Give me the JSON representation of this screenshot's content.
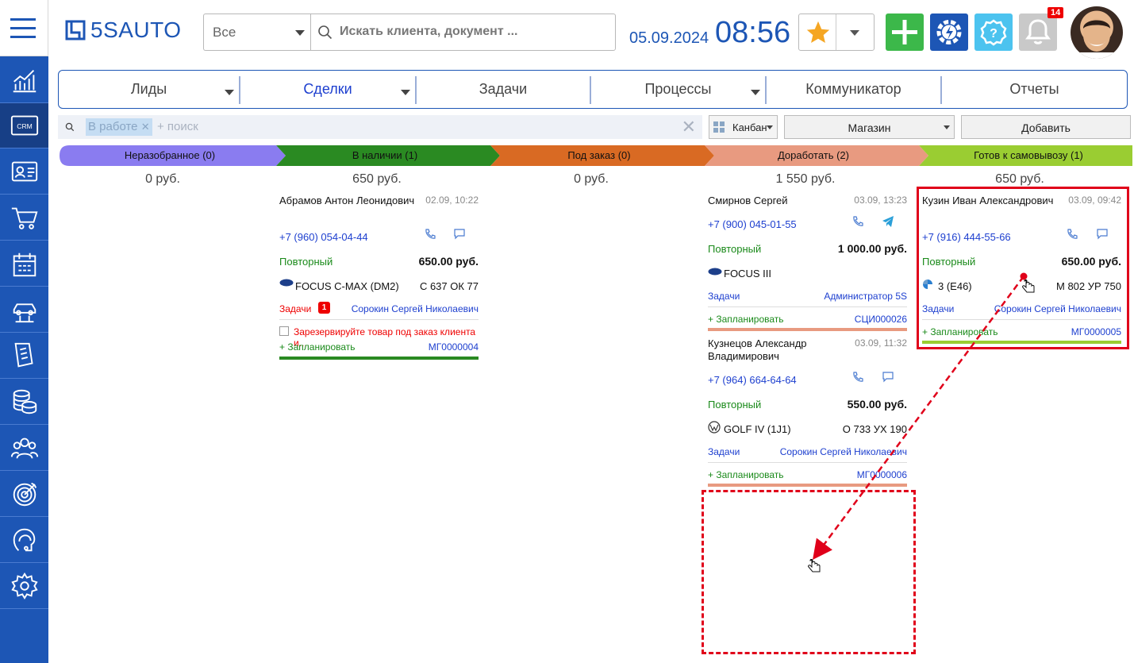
{
  "header": {
    "logo_text": "5SAUTO",
    "search_scope": "Все",
    "search_placeholder": "Искать клиента, документ ...",
    "date": "05.09.2024",
    "time": "08:56",
    "notifications_count": "14"
  },
  "sidebar": {
    "items": [
      "analytics-icon",
      "crm-icon",
      "contacts-icon",
      "cart-icon",
      "calendar-icon",
      "car-lift-icon",
      "documents-icon",
      "finance-icon",
      "team-icon",
      "target-icon",
      "support-icon",
      "settings-icon"
    ],
    "crm_label": "CRM"
  },
  "tabs": [
    {
      "label": "Лиды"
    },
    {
      "label": "Сделки"
    },
    {
      "label": "Задачи"
    },
    {
      "label": "Процессы"
    },
    {
      "label": "Коммуникатор"
    },
    {
      "label": "Отчеты"
    }
  ],
  "toolbar": {
    "filter_chip": "В работе",
    "filter_placeholder": "+ поиск",
    "view_label": "Канбан",
    "store_label": "Магазин",
    "add_label": "Добавить"
  },
  "stages": [
    {
      "label": "Неразобранное (0)",
      "sum": "0 руб.",
      "color": "#8a7cf0"
    },
    {
      "label": "В наличии (1)",
      "sum": "650 руб.",
      "color": "#2a8a22"
    },
    {
      "label": "Под заказ (0)",
      "sum": "0 руб.",
      "color": "#d96a23"
    },
    {
      "label": "Доработать (2)",
      "sum": "1 550 руб.",
      "color": "#e89a80"
    },
    {
      "label": "Готов к самовывозу (1)",
      "sum": "650 руб.",
      "color": "#9acd32"
    }
  ],
  "cards": {
    "abramov": {
      "name": "Абрамов Антон Леонидович",
      "datetime": "02.09, 10:22",
      "phone": "+7 (960) 054-04-44",
      "kind": "Повторный",
      "price": "650.00 руб.",
      "car": "FOCUS C-MAX (DM2)",
      "plate": "С 637 ОК 77",
      "tasks_label": "Задачи",
      "tasks_badge": "1",
      "responsible": "Сорокин Сергей Николаевич",
      "task_text": "Зарезервируйте товар под заказ клиента и...",
      "plan": "+ Запланировать",
      "number": "МГ0000004"
    },
    "smirnov": {
      "name": "Смирнов Сергей",
      "datetime": "03.09, 13:23",
      "phone": "+7 (900) 045-01-55",
      "kind": "Повторный",
      "price": "1 000.00 руб.",
      "car": "FOCUS III",
      "tasks_label": "Задачи",
      "responsible": "Администратор 5S",
      "plan": "+ Запланировать",
      "number": "СЦИ000026"
    },
    "kuznetsov": {
      "name": "Кузнецов Александр Владимирович",
      "datetime": "03.09, 11:32",
      "phone": "+7 (964) 664-64-64",
      "kind": "Повторный",
      "price": "550.00 руб.",
      "car": "GOLF IV (1J1)",
      "plate": "О 733 УХ 190",
      "tasks_label": "Задачи",
      "responsible": "Сорокин Сергей Николаевич",
      "plan": "+ Запланировать",
      "number": "МГ0000006"
    },
    "kuzin": {
      "name": "Кузин Иван Александрович",
      "datetime": "03.09, 09:42",
      "phone": "+7 (916) 444-55-66",
      "kind": "Повторный",
      "price": "650.00 руб.",
      "car": "3 (E46)",
      "plate": "М 802 УР 750",
      "tasks_label": "Задачи",
      "responsible": "Сорокин Сергей Николаевич",
      "plan": "+ Запланировать",
      "number": "МГ0000005"
    }
  },
  "colors": {
    "brand": "#1d56b5",
    "annotation": "#e0001a"
  }
}
